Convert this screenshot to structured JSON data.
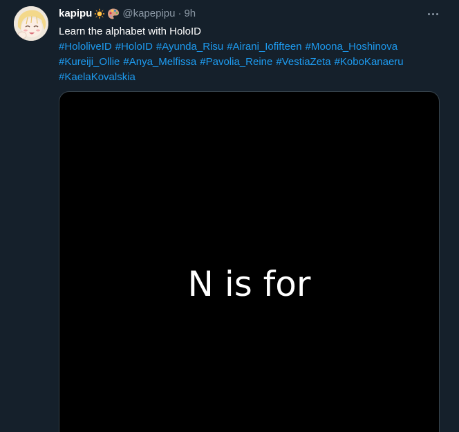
{
  "tweet": {
    "display_name": "kapipu",
    "name_emojis": [
      "sun-emoji",
      "palette-emoji"
    ],
    "handle": "@kapepipu",
    "separator": "·",
    "time": "9h",
    "text": "Learn the alphabet with HoloID",
    "hashtags": [
      "#HololiveID",
      "#HoloID",
      "#Ayunda_Risu",
      "#Airani_Iofifteen",
      "#Moona_Hoshinova",
      "#Kureiji_Ollie",
      "#Anya_Melfissa",
      "#Pavolia_Reine",
      "#VestiaZeta",
      "#KoboKanaeru",
      "#KaelaKovalskia"
    ],
    "media": {
      "caption": "N is for"
    },
    "more_icon": "more-horizontal-icon"
  },
  "colors": {
    "background": "#15202b",
    "link": "#1d9bf0",
    "secondary_text": "#8b98a5",
    "media_bg": "#000000"
  }
}
